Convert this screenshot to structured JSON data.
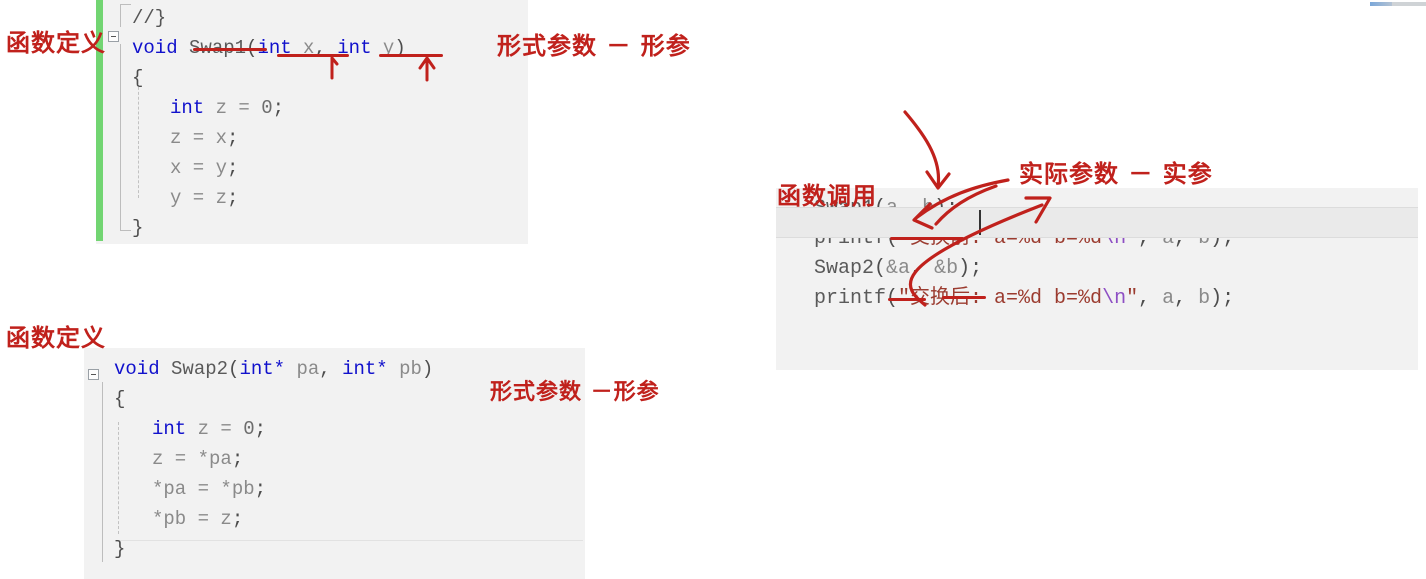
{
  "app": {
    "kind": "code-editor-screenshot",
    "accent_red": "#c0211c",
    "keyword_blue": "#1111cc",
    "panel_bg": "#f2f2f2",
    "change_bar_green": "#72d572"
  },
  "panel_swap1": {
    "name": "Swap1 function definition",
    "lines": [
      {
        "indent": 0,
        "tokens": [
          {
            "t": "//}",
            "c": "plain"
          }
        ]
      },
      {
        "indent": 0,
        "tokens": [
          {
            "t": "void ",
            "c": "kw"
          },
          {
            "t": "Swap1",
            "c": "fn"
          },
          {
            "t": "(",
            "c": "punc"
          },
          {
            "t": "int",
            "c": "kw"
          },
          {
            "t": " x",
            "c": "id"
          },
          {
            "t": ", ",
            "c": "punc"
          },
          {
            "t": "int",
            "c": "kw"
          },
          {
            "t": " y",
            "c": "id"
          },
          {
            "t": ")",
            "c": "punc"
          }
        ]
      },
      {
        "indent": 0,
        "tokens": [
          {
            "t": "{",
            "c": "punc"
          }
        ]
      },
      {
        "indent": 1,
        "tokens": [
          {
            "t": "int",
            "c": "kw"
          },
          {
            "t": " z = ",
            "c": "id"
          },
          {
            "t": "0",
            "c": "num"
          },
          {
            "t": ";",
            "c": "punc"
          }
        ]
      },
      {
        "indent": 1,
        "tokens": [
          {
            "t": "z = x",
            "c": "id"
          },
          {
            "t": ";",
            "c": "punc"
          }
        ]
      },
      {
        "indent": 1,
        "tokens": [
          {
            "t": "x = y",
            "c": "id"
          },
          {
            "t": ";",
            "c": "punc"
          }
        ]
      },
      {
        "indent": 1,
        "tokens": [
          {
            "t": "y = z",
            "c": "id"
          },
          {
            "t": ";",
            "c": "punc"
          }
        ]
      },
      {
        "indent": 0,
        "tokens": [
          {
            "t": "}",
            "c": "punc"
          }
        ]
      }
    ]
  },
  "panel_swap2": {
    "name": "Swap2 function definition",
    "lines": [
      {
        "indent": 0,
        "tokens": [
          {
            "t": "void ",
            "c": "kw"
          },
          {
            "t": "Swap2",
            "c": "fn"
          },
          {
            "t": "(",
            "c": "punc"
          },
          {
            "t": "int*",
            "c": "kw"
          },
          {
            "t": " pa",
            "c": "id"
          },
          {
            "t": ", ",
            "c": "punc"
          },
          {
            "t": "int*",
            "c": "kw"
          },
          {
            "t": " pb",
            "c": "id"
          },
          {
            "t": ")",
            "c": "punc"
          }
        ]
      },
      {
        "indent": 0,
        "tokens": [
          {
            "t": "{",
            "c": "punc"
          }
        ]
      },
      {
        "indent": 1,
        "tokens": [
          {
            "t": "int",
            "c": "kw"
          },
          {
            "t": " z = ",
            "c": "id"
          },
          {
            "t": "0",
            "c": "num"
          },
          {
            "t": ";",
            "c": "punc"
          }
        ]
      },
      {
        "indent": 1,
        "tokens": [
          {
            "t": "z = *pa",
            "c": "id"
          },
          {
            "t": ";",
            "c": "punc"
          }
        ]
      },
      {
        "indent": 1,
        "tokens": [
          {
            "t": "*pa = *pb",
            "c": "id"
          },
          {
            "t": ";",
            "c": "punc"
          }
        ]
      },
      {
        "indent": 1,
        "tokens": [
          {
            "t": "*pb = z",
            "c": "id"
          },
          {
            "t": ";",
            "c": "punc"
          }
        ]
      },
      {
        "indent": 0,
        "tokens": [
          {
            "t": "}",
            "c": "punc"
          }
        ]
      }
    ]
  },
  "panel_calls": {
    "name": "function call site",
    "lines": [
      {
        "indent": 0,
        "tokens": [
          {
            "t": "Swap1",
            "c": "fn"
          },
          {
            "t": "(",
            "c": "punc"
          },
          {
            "t": "a",
            "c": "id"
          },
          {
            "t": ", ",
            "c": "punc"
          },
          {
            "t": "b",
            "c": "id"
          },
          {
            "t": ");",
            "c": "punc"
          }
        ]
      },
      {
        "indent": 0,
        "tokens": [
          {
            "t": "printf",
            "c": "fn"
          },
          {
            "t": "(",
            "c": "punc"
          },
          {
            "t": "\"交换前: a=%d b=%d",
            "c": "str"
          },
          {
            "t": "\\n",
            "c": "esc"
          },
          {
            "t": "\"",
            "c": "str"
          },
          {
            "t": ", ",
            "c": "punc"
          },
          {
            "t": "a",
            "c": "id"
          },
          {
            "t": ", ",
            "c": "punc"
          },
          {
            "t": "b",
            "c": "id"
          },
          {
            "t": ");",
            "c": "punc"
          }
        ]
      },
      {
        "indent": 0,
        "tokens": [
          {
            "t": "Swap2",
            "c": "fn"
          },
          {
            "t": "(",
            "c": "punc"
          },
          {
            "t": "&a",
            "c": "id"
          },
          {
            "t": ", ",
            "c": "punc"
          },
          {
            "t": "&b",
            "c": "id"
          },
          {
            "t": ");",
            "c": "punc"
          }
        ]
      },
      {
        "indent": 0,
        "tokens": [
          {
            "t": "printf",
            "c": "fn"
          },
          {
            "t": "(",
            "c": "punc"
          },
          {
            "t": "\"交换后: a=%d b=%d",
            "c": "str"
          },
          {
            "t": "\\n",
            "c": "esc"
          },
          {
            "t": "\"",
            "c": "str"
          },
          {
            "t": ", ",
            "c": "punc"
          },
          {
            "t": "a",
            "c": "id"
          },
          {
            "t": ", ",
            "c": "punc"
          },
          {
            "t": "b",
            "c": "id"
          },
          {
            "t": ");",
            "c": "punc"
          }
        ]
      }
    ]
  },
  "annotations": {
    "def_label_top": "函数定义",
    "formal_param_top": "形式参数 － 形参",
    "def_label_bottom": "函数定义",
    "formal_param_bottom": "形式参数 －形参",
    "call_label": "函数调用",
    "actual_param": "实际参数 － 实参"
  }
}
